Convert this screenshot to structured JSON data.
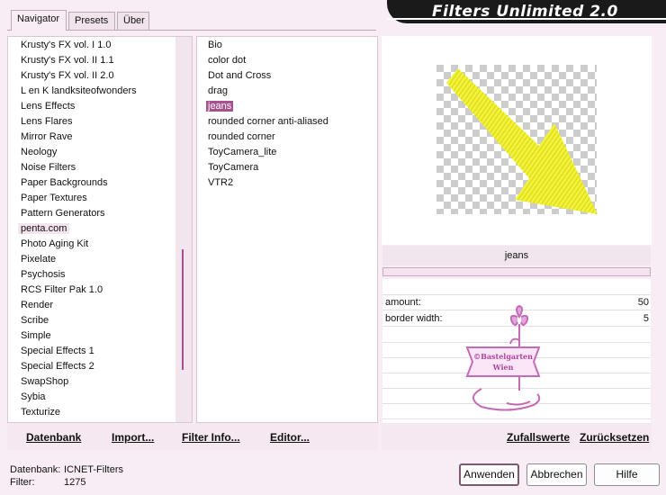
{
  "tabs": [
    "Navigator",
    "Presets",
    "Über"
  ],
  "app_title": "Filters Unlimited 2.0",
  "categories": [
    "Krusty's FX vol. I 1.0",
    "Krusty's FX vol. II 1.1",
    "Krusty's FX vol. II 2.0",
    "L en K landksiteofwonders",
    "Lens Effects",
    "Lens Flares",
    "Mirror Rave",
    "Neology",
    "Noise Filters",
    "Paper Backgrounds",
    "Paper Textures",
    "Pattern Generators",
    "penta.com",
    "Photo Aging Kit",
    "Pixelate",
    "Psychosis",
    "RCS Filter Pak 1.0",
    "Render",
    "Scribe",
    "Simple",
    "Special Effects 1",
    "Special Effects 2",
    "SwapShop",
    "Sybia",
    "Texturize"
  ],
  "selected_category": "penta.com",
  "filters": [
    "Bio",
    "color dot",
    "Dot and Cross",
    "drag",
    "jeans",
    "rounded corner anti-aliased",
    "rounded corner",
    "ToyCamera_lite",
    "ToyCamera",
    "VTR2"
  ],
  "selected_filter": "jeans",
  "preview": {
    "arrow_color": "#f2f23a"
  },
  "filter_name": "jeans",
  "params": [
    {
      "label": "amount:",
      "value": "50"
    },
    {
      "label": "border width:",
      "value": "5"
    }
  ],
  "watermark": {
    "line1": "©Bastelgarten",
    "line2": "Wien"
  },
  "toolbar": {
    "datenbank": "Datenbank",
    "import": "Import...",
    "filter_info": "Filter Info...",
    "editor": "Editor...",
    "zufallswerte": "Zufallswerte",
    "zuruecksetzen": "Zurücksetzen"
  },
  "status": {
    "db_label": "Datenbank:",
    "db_value": "ICNET-Filters",
    "filter_label": "Filter:",
    "filter_value": "1275"
  },
  "buttons": {
    "apply": "Anwenden",
    "cancel": "Abbrechen",
    "help": "Hilfe"
  },
  "colors": {
    "accent": "#a7528f",
    "background": "#f8edf4"
  }
}
